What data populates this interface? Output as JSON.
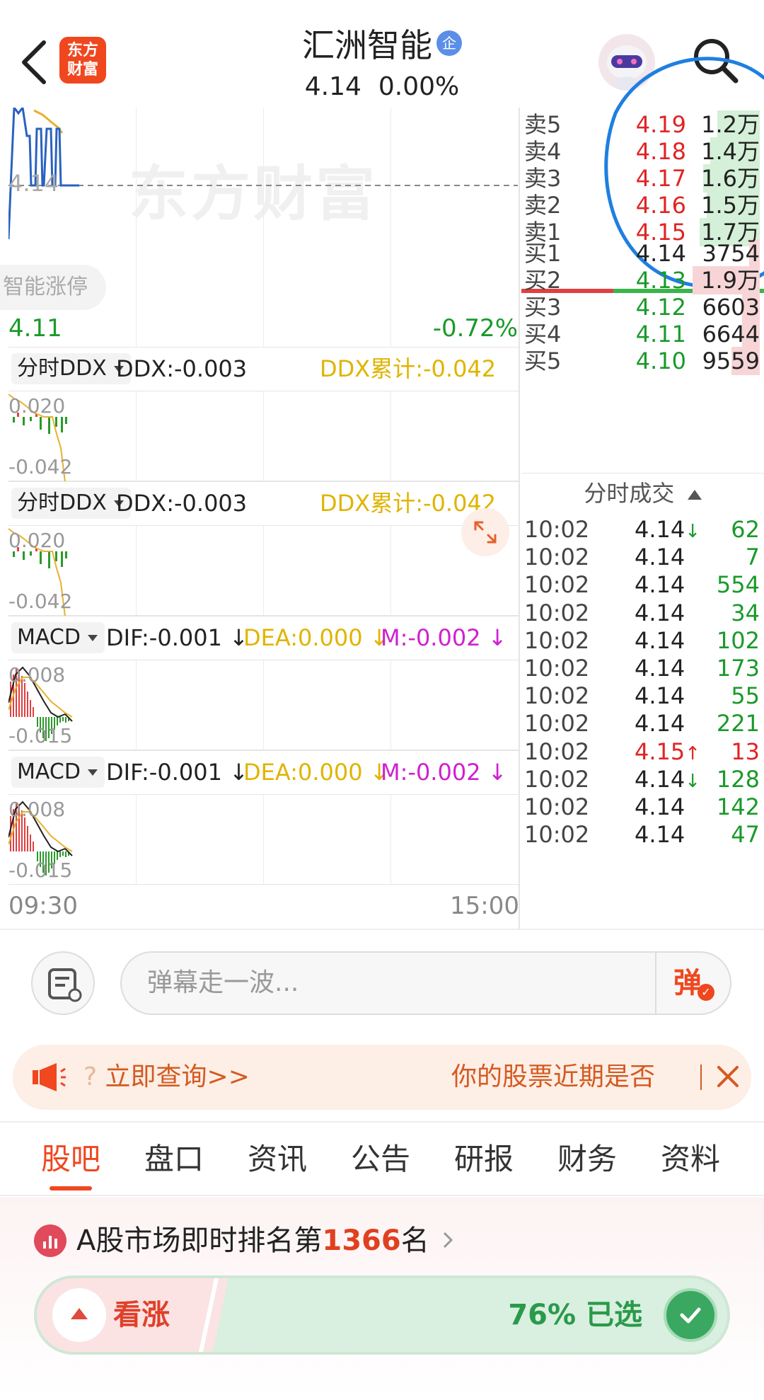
{
  "header": {
    "app_logo_line1": "东方",
    "app_logo_line2": "财富",
    "stock_name": "汇洲智能",
    "stock_badge": "企",
    "price": "4.14",
    "change_pct": "0.00%"
  },
  "chart": {
    "watermark": "东方财富",
    "ref_price": "4.14",
    "low_price": "4.11",
    "low_pct": "-0.72%",
    "tag": "智能涨停",
    "time_start": "09:30",
    "time_end": "15:00"
  },
  "indicators": [
    {
      "selector": "分时DDX",
      "v1": "DDX:-0.003",
      "v2": "DDX累计:-0.042",
      "top": "0.020",
      "bottom": "-0.042"
    },
    {
      "selector": "分时DDX",
      "v1": "DDX:-0.003",
      "v2": "DDX累计:-0.042",
      "top": "0.020",
      "bottom": "-0.042"
    },
    {
      "selector": "MACD",
      "dif": "DIF:-0.001 ↓",
      "dea": "DEA:0.000 ↓",
      "m": "M:-0.002 ↓",
      "top": "0.008",
      "bottom": "-0.015"
    },
    {
      "selector": "MACD",
      "dif": "DIF:-0.001 ↓",
      "dea": "DEA:0.000 ↓",
      "m": "M:-0.002 ↓",
      "top": "0.008",
      "bottom": "-0.015"
    }
  ],
  "orderbook": {
    "asks": [
      {
        "name": "卖5",
        "price": "4.19",
        "vol": "1.2万",
        "fill": 0.6
      },
      {
        "name": "卖4",
        "price": "4.18",
        "vol": "1.4万",
        "fill": 0.7
      },
      {
        "name": "卖3",
        "price": "4.17",
        "vol": "1.6万",
        "fill": 0.8
      },
      {
        "name": "卖2",
        "price": "4.16",
        "vol": "1.5万",
        "fill": 0.75
      },
      {
        "name": "卖1",
        "price": "4.15",
        "vol": "1.7万",
        "fill": 0.85
      }
    ],
    "bids": [
      {
        "name": "买1",
        "price": "4.14",
        "vol": "3754",
        "fill": 0.15
      },
      {
        "name": "买2",
        "price": "4.13",
        "vol": "1.9万",
        "fill": 0.95
      },
      {
        "name": "买3",
        "price": "4.12",
        "vol": "6603",
        "fill": 0.25
      },
      {
        "name": "买4",
        "price": "4.11",
        "vol": "6644",
        "fill": 0.25
      },
      {
        "name": "买5",
        "price": "4.10",
        "vol": "9559",
        "fill": 0.4
      }
    ]
  },
  "ticks": {
    "header": "分时成交",
    "rows": [
      {
        "time": "10:02",
        "price": "4.14",
        "dir": "↓",
        "vol": "62",
        "color": "dark"
      },
      {
        "time": "10:02",
        "price": "4.14",
        "dir": "",
        "vol": "7",
        "color": "dark"
      },
      {
        "time": "10:02",
        "price": "4.14",
        "dir": "",
        "vol": "554",
        "color": "dark"
      },
      {
        "time": "10:02",
        "price": "4.14",
        "dir": "",
        "vol": "34",
        "color": "dark"
      },
      {
        "time": "10:02",
        "price": "4.14",
        "dir": "",
        "vol": "102",
        "color": "dark"
      },
      {
        "time": "10:02",
        "price": "4.14",
        "dir": "",
        "vol": "173",
        "color": "dark"
      },
      {
        "time": "10:02",
        "price": "4.14",
        "dir": "",
        "vol": "55",
        "color": "dark"
      },
      {
        "time": "10:02",
        "price": "4.14",
        "dir": "",
        "vol": "221",
        "color": "dark"
      },
      {
        "time": "10:02",
        "price": "4.15",
        "dir": "↑",
        "vol": "13",
        "color": "red"
      },
      {
        "time": "10:02",
        "price": "4.14",
        "dir": "↓",
        "vol": "128",
        "color": "dark"
      },
      {
        "time": "10:02",
        "price": "4.14",
        "dir": "",
        "vol": "142",
        "color": "dark"
      },
      {
        "time": "10:02",
        "price": "4.14",
        "dir": "",
        "vol": "47",
        "color": "dark"
      }
    ]
  },
  "comment": {
    "placeholder": "弹幕走一波...",
    "danmu_label": "弹"
  },
  "banner": {
    "left_faint": "‌?",
    "left_text": " 立即查询>>",
    "right_text": "你的股票近期是否"
  },
  "tabs": [
    "股吧",
    "盘口",
    "资讯",
    "公告",
    "研报",
    "财务",
    "资料"
  ],
  "rank": {
    "prefix": "A股市场即时排名第",
    "number": "1366",
    "suffix": "名"
  },
  "vote": {
    "up_label": "看涨",
    "pct": "76% 已选",
    "bull_fraction": 0.76
  },
  "colors": {
    "brand": "#f0471f",
    "up": "#e02424",
    "down": "#1a9a2a",
    "dea": "#e0b400",
    "m": "#d020d0"
  }
}
